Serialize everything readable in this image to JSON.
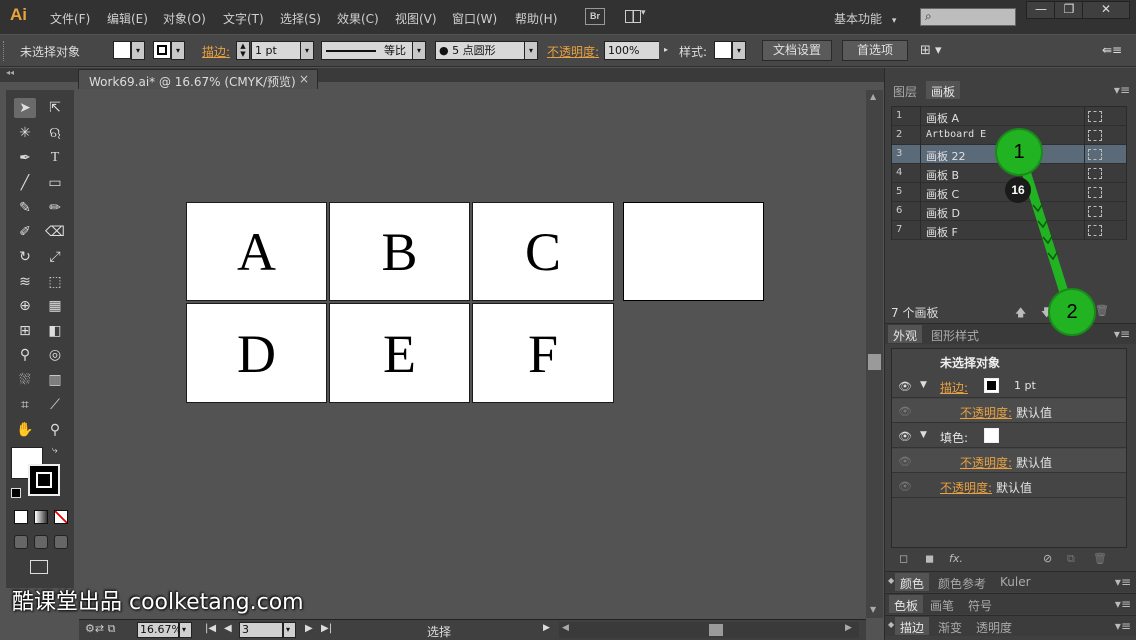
{
  "app": {
    "logo": "Ai"
  },
  "menu": [
    "文件(F)",
    "编辑(E)",
    "对象(O)",
    "文字(T)",
    "选择(S)",
    "效果(C)",
    "视图(V)",
    "窗口(W)",
    "帮助(H)"
  ],
  "menubar": {
    "bridge": "Br",
    "workspace": "基本功能",
    "workspace_arrow": "▾",
    "search_icon": "⌕"
  },
  "window_buttons": {
    "minimize": "—",
    "restore": "❐",
    "close": "✕"
  },
  "control_bar": {
    "selection": "未选择对象",
    "stroke_label": "描边:",
    "stroke_weight": "1 pt",
    "stroke_profile": "等比",
    "brush": "● 5 点圆形",
    "opacity_label": "不透明度:",
    "opacity_value": "100%",
    "style_label": "样式:",
    "doc_setup": "文档设置",
    "preferences": "首选项"
  },
  "document": {
    "tab_title": "Work69.ai* @ 16.67% (CMYK/预览)",
    "close": "×"
  },
  "artboards_on_canvas": [
    "A",
    "B",
    "C",
    "",
    "D",
    "E",
    "F"
  ],
  "status_bar": {
    "zoom": "16.67%",
    "page": "3",
    "mode": "选择"
  },
  "panel_artboards": {
    "tabs": [
      "图层",
      "画板"
    ],
    "active_tab": "画板",
    "rows": [
      {
        "num": "1",
        "name": "画板 A"
      },
      {
        "num": "2",
        "name": "Artboard E"
      },
      {
        "num": "3",
        "name": "画板 22"
      },
      {
        "num": "4",
        "name": "画板 B"
      },
      {
        "num": "5",
        "name": "画板 C"
      },
      {
        "num": "6",
        "name": "画板 D"
      },
      {
        "num": "7",
        "name": "画板 F"
      }
    ],
    "selected_index": 2,
    "count": "7 个画板"
  },
  "panel_appearance": {
    "tabs": [
      "外观",
      "图形样式"
    ],
    "title": "未选择对象",
    "stroke_label": "描边:",
    "stroke_value": "1 pt",
    "opacity_label": "不透明度:",
    "opacity_value": "默认值",
    "fill_label": "填色:",
    "fx": "fx."
  },
  "panel_color": {
    "tabs": [
      "颜色",
      "颜色参考",
      "Kuler"
    ]
  },
  "panel_swatches": {
    "tabs": [
      "色板",
      "画笔",
      "符号"
    ]
  },
  "panel_stroke": {
    "tabs": [
      "描边",
      "渐变",
      "透明度"
    ]
  },
  "annotations": {
    "step1": "1",
    "step2": "2",
    "badge": "16"
  },
  "watermark": "酷课堂出品 coolketang.com",
  "colors": {
    "accent_orange": "#e8a040",
    "annotation_green": "#22b322",
    "selected_row": "#5b6a78"
  }
}
